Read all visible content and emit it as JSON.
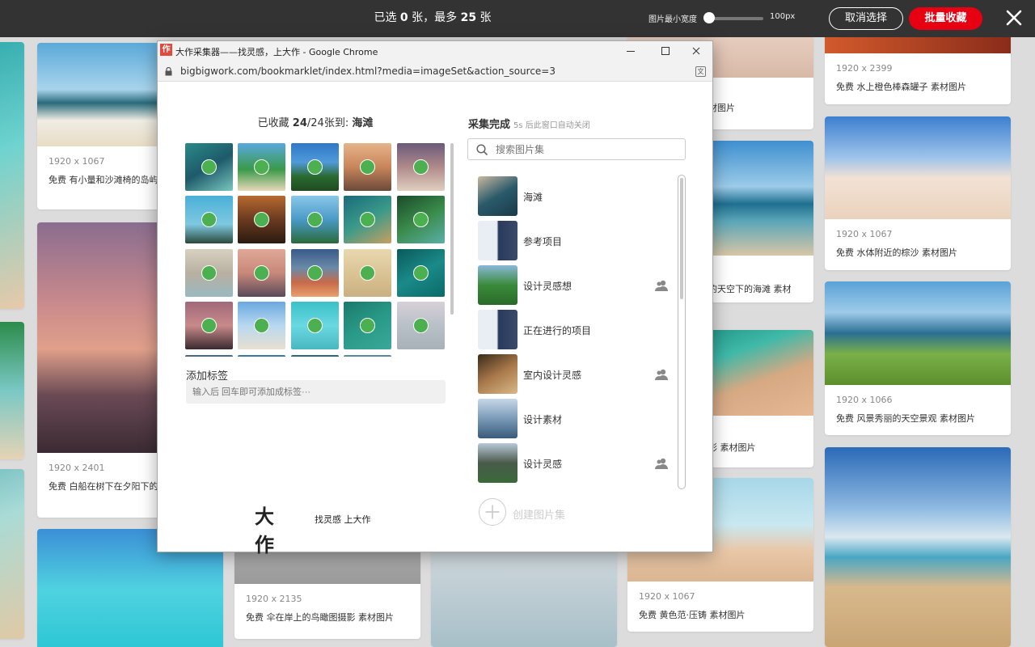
{
  "topbar": {
    "selected_text_pre": "已选 ",
    "selected_count": "0",
    "selected_text_mid": " 张，最多 ",
    "max_count": "25",
    "selected_text_post": " 张",
    "width_label": "图片最小宽度",
    "width_value": "100px",
    "cancel_label": "取消选择",
    "batch_label": "批量收藏",
    "close_icon": "close-icon"
  },
  "background_cards": [
    {
      "dim": "1920 x 1067",
      "desc": "免费 有小量和沙滩椅的岛屿 素材图片"
    },
    {
      "dim": "1920 x 2401",
      "desc": "免费 白船在树下在夕阳下的 素材图片"
    },
    {
      "dim": "1920 x 2135",
      "desc": "免费 伞在岸上的鸟瞰图摄影 素材图片"
    },
    {
      "dim": "",
      "desc": "材图片"
    },
    {
      "dim": "",
      "desc": "的天空下的海滩 素材"
    },
    {
      "dim": "",
      "desc": "影 素材图片"
    },
    {
      "dim": "1920 x 1067",
      "desc": "免费 黄色范·压铸 素材图片"
    },
    {
      "dim": "1920 x 2399",
      "desc": "免费 水上橙色棒森罐子 素材图片"
    },
    {
      "dim": "1920 x 1067",
      "desc": "免费 水体附近的棕沙 素材图片"
    },
    {
      "dim": "1920 x 1066",
      "desc": "免费 风景秀丽的天空景观 素材图片"
    }
  ],
  "popup": {
    "window_title": "大作采集器——找灵感，上大作 - Google Chrome",
    "app_icon_text": "作",
    "url": "bigbigwork.com/bookmarklet/index.html?media=imageSet&action_source=3",
    "collected_pre": "已收藏 ",
    "collected_count": "24",
    "collected_mid": "/24张到:  ",
    "collected_board": "海滩",
    "tag_label": "添加标签",
    "tag_placeholder": "输入后 回车即可添加成标签···",
    "logo_text": "大作",
    "logo_slogan": "找灵感 上大作",
    "done_title": "采集完成",
    "done_sub": "5s 后此窗口自动关闭",
    "search_placeholder": "搜索图片集",
    "create_label": "创建图片集",
    "boards": [
      {
        "name": "海滩",
        "shared": false
      },
      {
        "name": "参考项目",
        "shared": false
      },
      {
        "name": "设计灵感想",
        "shared": true
      },
      {
        "name": "正在进行的项目",
        "shared": false
      },
      {
        "name": "室内设计灵感",
        "shared": true
      },
      {
        "name": "设计素材",
        "shared": false
      },
      {
        "name": "设计灵感",
        "shared": true
      }
    ]
  },
  "colors": {
    "accent_red": "#e60012",
    "check_green": "#4caf50",
    "topbar_bg": "#333333"
  }
}
